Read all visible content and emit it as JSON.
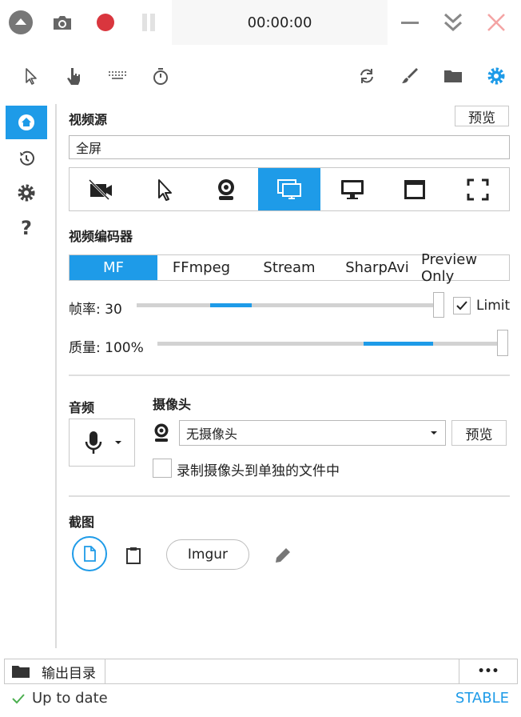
{
  "header": {
    "timer": "00:00:00"
  },
  "source": {
    "title": "视频源",
    "preview_label": "预览",
    "current": "全屏",
    "options": [
      {
        "icon": "no-camera-icon"
      },
      {
        "icon": "pointer-icon"
      },
      {
        "icon": "webcam-icon"
      },
      {
        "icon": "screens-icon"
      },
      {
        "icon": "monitor-icon"
      },
      {
        "icon": "window-icon"
      },
      {
        "icon": "region-icon"
      }
    ],
    "active_index": 3
  },
  "encoder": {
    "title": "视频编码器",
    "options": [
      "MF",
      "FFmpeg",
      "Stream",
      "SharpAvi",
      "Preview Only"
    ],
    "active_index": 0
  },
  "framerate": {
    "label": "帧率: 30",
    "limit_label": "Limit",
    "limit_checked": true
  },
  "quality": {
    "label": "质量: 100%"
  },
  "audio": {
    "title": "音频"
  },
  "webcam": {
    "title": "摄像头",
    "selected": "无摄像头",
    "preview_label": "预览",
    "separate_file_label": "录制摄像头到单独的文件中",
    "separate_file_checked": false
  },
  "screenshot": {
    "title": "截图",
    "imgur_label": "Imgur"
  },
  "output": {
    "label": "输出目录",
    "path": "",
    "more_label": "•••"
  },
  "status": {
    "text": "Up to date",
    "channel": "STABLE"
  },
  "colors": {
    "accent": "#1e9be8",
    "record": "#d9363e",
    "close": "#f4a4a4"
  }
}
